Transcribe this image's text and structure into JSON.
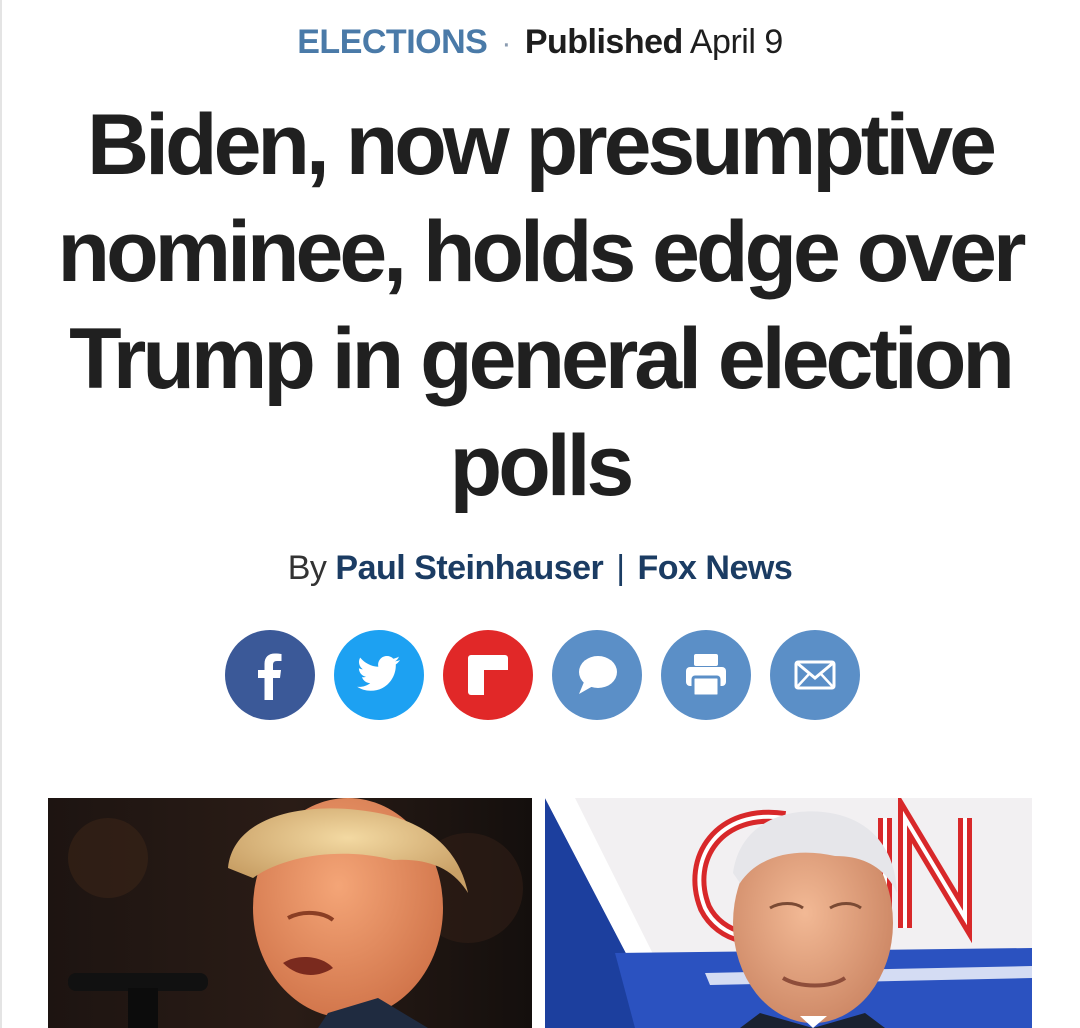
{
  "article": {
    "category": "ELECTIONS",
    "separator": "·",
    "published_label": "Published",
    "published_date": "April 9",
    "headline": "Biden, now presumptive nominee, holds edge over Trump in general election polls",
    "byline": {
      "prefix": "By",
      "author": "Paul Steinhauser",
      "separator": "|",
      "outlet": "Fox News"
    }
  },
  "share": {
    "buttons": [
      {
        "name": "facebook",
        "icon": "facebook-icon",
        "color": "#3b5998"
      },
      {
        "name": "twitter",
        "icon": "twitter-icon",
        "color": "#1da1f2"
      },
      {
        "name": "flipboard",
        "icon": "flipboard-icon",
        "color": "#e12828"
      },
      {
        "name": "comments",
        "icon": "comment-icon",
        "color": "#5b8fc7"
      },
      {
        "name": "print",
        "icon": "print-icon",
        "color": "#5b8fc7"
      },
      {
        "name": "email",
        "icon": "envelope-icon",
        "color": "#5b8fc7"
      }
    ]
  },
  "photos": {
    "left": {
      "subject": "trump-photo"
    },
    "right": {
      "subject": "biden-photo"
    }
  },
  "colors": {
    "category": "#4a7aa8",
    "byline_link": "#1b3c63",
    "headline": "#202020"
  }
}
